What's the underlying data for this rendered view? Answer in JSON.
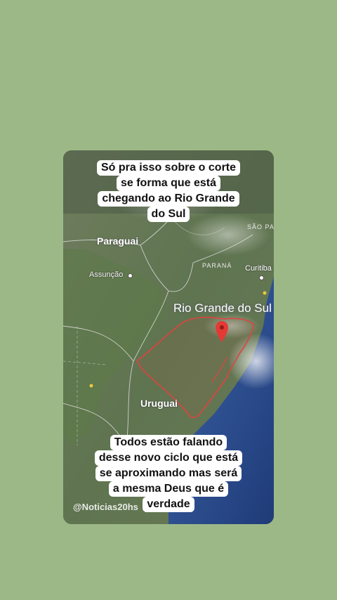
{
  "caption_top": {
    "lines": [
      "Só pra isso sobre o corte",
      "se forma que está",
      "chegando ao Rio Grande",
      "do Sul"
    ]
  },
  "caption_bottom": {
    "lines": [
      "Todos estão falando",
      "desse novo ciclo que está",
      "se aproximando mas será",
      "a mesma Deus que é",
      "verdade"
    ]
  },
  "map": {
    "highlight_region": "Rio Grande do Sul",
    "labels": {
      "paraguai": "Paraguai",
      "uruguai": "Uruguai",
      "assuncao": "Assunção",
      "curitiba": "Curitiba",
      "parana": "PARANÁ",
      "sao_paulo": "SÃO PAU"
    },
    "marker": "location-pin-icon",
    "colors": {
      "border_highlight": "#e0433f",
      "pin": "#e53935",
      "land": "#6b7a5a",
      "ocean": "#2a4a8c"
    }
  },
  "watermark": "@Noticias20hs",
  "colors": {
    "background": "#9db887",
    "caption_bg": "#ffffff"
  }
}
